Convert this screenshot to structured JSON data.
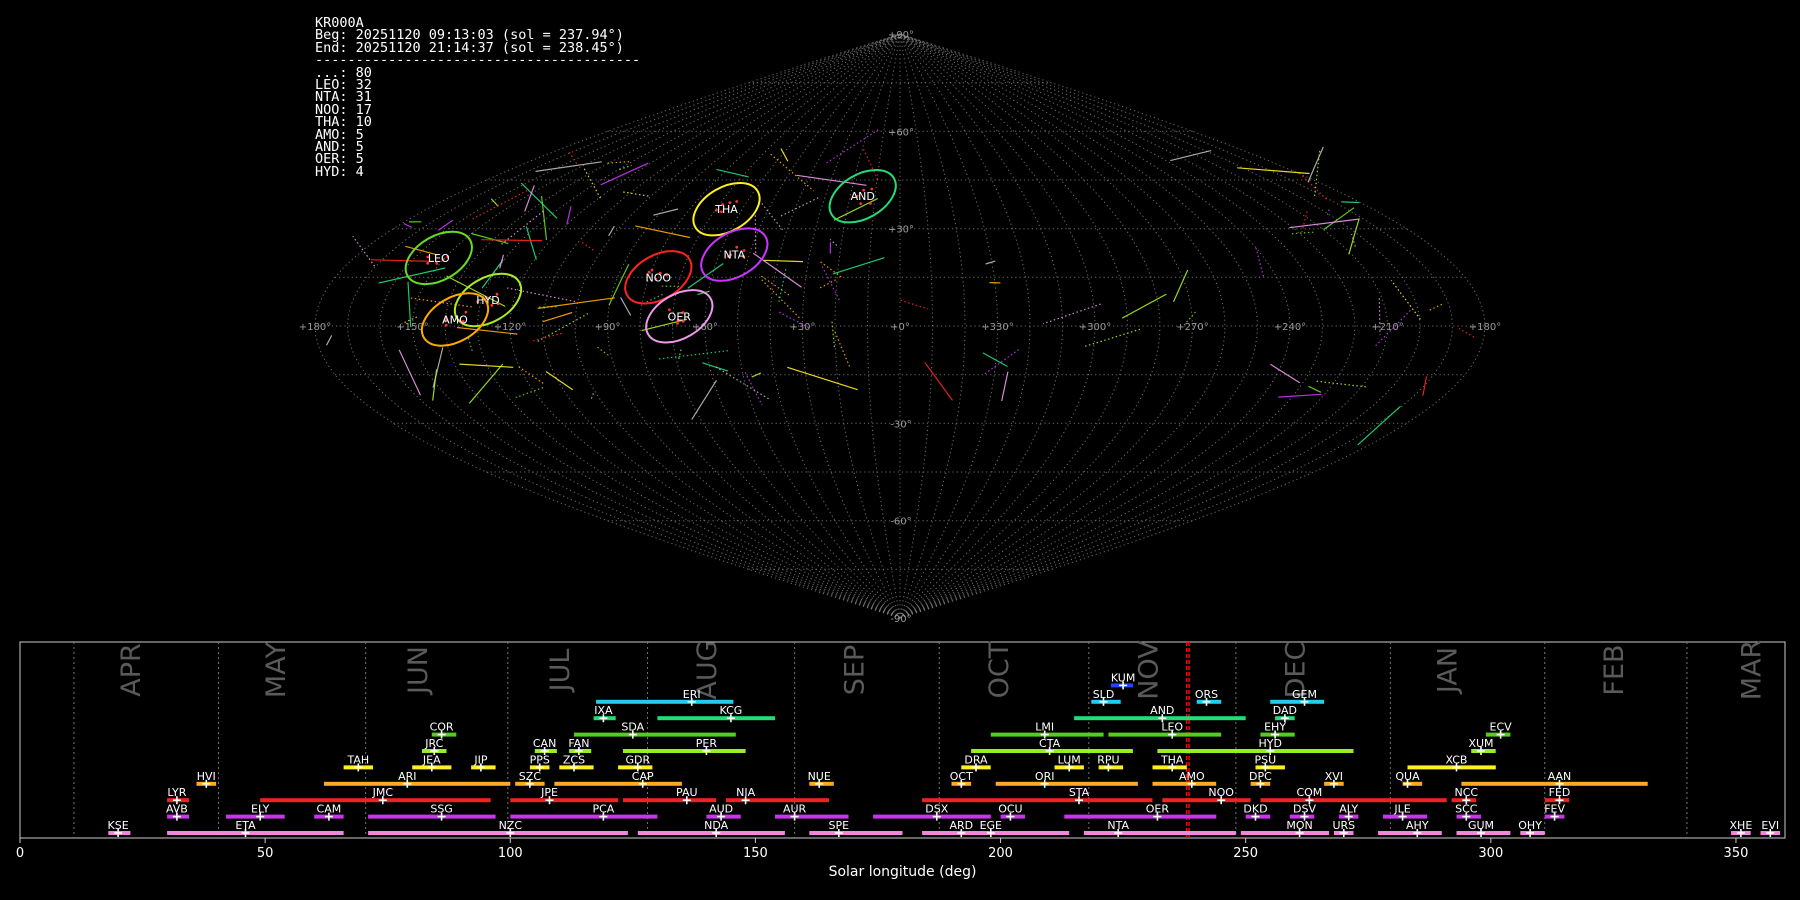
{
  "stats": {
    "station": "KR000A",
    "beg": "Beg: 20251120 09:13:03 (sol = 237.94°)",
    "end": "End: 20251120 21:14:37 (sol = 238.45°)",
    "separator": "----------------------------------------",
    "counts": [
      {
        "code": "...",
        "n": 80
      },
      {
        "code": "LEO",
        "n": 32
      },
      {
        "code": "NTA",
        "n": 31
      },
      {
        "code": "NOO",
        "n": 17
      },
      {
        "code": "THA",
        "n": 10
      },
      {
        "code": "AMO",
        "n": 5
      },
      {
        "code": "AND",
        "n": 5
      },
      {
        "code": "OER",
        "n": 5
      },
      {
        "code": "HYD",
        "n": 4
      }
    ]
  },
  "colors": {
    "background": "#000000",
    "grid": "#808080",
    "now_marker": "#ff0000"
  },
  "chart_data": [
    {
      "type": "scatter",
      "projection": "sinusoidal",
      "lon_tick_labels": [
        "+180°",
        "+150°",
        "+120°",
        "+90°",
        "+60°",
        "+30°",
        "+0°",
        "+330°",
        "+300°",
        "+270°",
        "+240°",
        "+210°",
        "+180°"
      ],
      "lat_tick_labels": [
        {
          "lat": 90,
          "label": "+90°"
        },
        {
          "lat": 60,
          "label": "+60°"
        },
        {
          "lat": 30,
          "label": "+30°"
        },
        {
          "lat": -30,
          "label": "-30°"
        },
        {
          "lat": -60,
          "label": "-60°"
        },
        {
          "lat": -90,
          "label": "-90°"
        }
      ],
      "radiants": [
        {
          "code": "LEO",
          "ra": 152,
          "dec": 21,
          "color": "#66dd22"
        },
        {
          "code": "THA",
          "ra": 66,
          "dec": 36,
          "color": "#ffee22"
        },
        {
          "code": "NTA",
          "ra": 55,
          "dec": 22,
          "color": "#cc33ff"
        },
        {
          "code": "AND",
          "ra": 15,
          "dec": 40,
          "color": "#22dd77"
        },
        {
          "code": "NOO",
          "ra": 77,
          "dec": 15,
          "color": "#ff2222"
        },
        {
          "code": "HYD",
          "ra": 128,
          "dec": 8,
          "color": "#aaee22"
        },
        {
          "code": "AMO",
          "ra": 137,
          "dec": 2,
          "color": "#ffaa00"
        },
        {
          "code": "OER",
          "ra": 68,
          "dec": 3,
          "color": "#ee99ee"
        }
      ]
    },
    {
      "type": "bar",
      "orientation": "horizontal",
      "xlabel": "Solar longitude (deg)",
      "xlim": [
        0,
        360
      ],
      "xticks": [
        0,
        50,
        100,
        150,
        200,
        250,
        300,
        350
      ],
      "current_sol": [
        237.94,
        238.45
      ],
      "months": [
        {
          "name": "APR",
          "start": 11.0,
          "label_at": 24.5
        },
        {
          "name": "MAY",
          "start": 40.5,
          "label_at": 54.0
        },
        {
          "name": "JUN",
          "start": 70.5,
          "label_at": 83.0
        },
        {
          "name": "JUL",
          "start": 99.5,
          "label_at": 112.0
        },
        {
          "name": "AUG",
          "start": 128.0,
          "label_at": 142.0
        },
        {
          "name": "SEP",
          "start": 158.0,
          "label_at": 172.0
        },
        {
          "name": "OCT",
          "start": 187.5,
          "label_at": 201.5
        },
        {
          "name": "NOV",
          "start": 218.0,
          "label_at": 232.0
        },
        {
          "name": "DEC",
          "start": 248.0,
          "label_at": 262.0
        },
        {
          "name": "JAN",
          "start": 279.5,
          "label_at": 293.0
        },
        {
          "name": "FEB",
          "start": 311.0,
          "label_at": 327.0
        },
        {
          "name": "MAR",
          "start": 340.0,
          "label_at": 355.0
        }
      ],
      "showers": [
        {
          "code": "KUM",
          "start": 222.5,
          "end": 227.0,
          "peak": 225.0,
          "row": 9,
          "color": "#2244ff"
        },
        {
          "code": "ERI",
          "start": 117.5,
          "end": 145.5,
          "peak": 137.0,
          "row": 8,
          "color": "#22ccee"
        },
        {
          "code": "SLD",
          "start": 218.5,
          "end": 224.5,
          "peak": 221.0,
          "row": 8,
          "color": "#22ccee"
        },
        {
          "code": "ORS",
          "start": 240.0,
          "end": 245.0,
          "peak": 242.0,
          "row": 8,
          "color": "#22ccee"
        },
        {
          "code": "GEM",
          "start": 255.0,
          "end": 266.0,
          "peak": 262.0,
          "row": 8,
          "color": "#22ccee"
        },
        {
          "code": "IXA",
          "start": 117.0,
          "end": 121.5,
          "peak": 119.0,
          "row": 7,
          "color": "#22dd77"
        },
        {
          "code": "KCG",
          "start": 130.0,
          "end": 154.0,
          "peak": 145.0,
          "row": 7,
          "color": "#22dd77"
        },
        {
          "code": "AND",
          "start": 215.0,
          "end": 250.0,
          "peak": 233.0,
          "row": 7,
          "color": "#22dd77"
        },
        {
          "code": "DAD",
          "start": 256.0,
          "end": 260.0,
          "peak": 258.0,
          "row": 7,
          "color": "#22dd77"
        },
        {
          "code": "COR",
          "start": 84.0,
          "end": 89.0,
          "peak": 86.0,
          "row": 6,
          "color": "#55cc22"
        },
        {
          "code": "SDA",
          "start": 113.0,
          "end": 146.0,
          "peak": 125.0,
          "row": 6,
          "color": "#55cc22"
        },
        {
          "code": "LMI",
          "start": 198.0,
          "end": 221.0,
          "peak": 209.0,
          "row": 6,
          "color": "#55cc22"
        },
        {
          "code": "LEO",
          "start": 222.0,
          "end": 245.0,
          "peak": 235.0,
          "row": 6,
          "color": "#55cc22"
        },
        {
          "code": "EHY",
          "start": 253.0,
          "end": 260.0,
          "peak": 256.0,
          "row": 6,
          "color": "#55cc22"
        },
        {
          "code": "ECV",
          "start": 299.0,
          "end": 304.0,
          "peak": 302.0,
          "row": 6,
          "color": "#55cc22"
        },
        {
          "code": "JRC",
          "start": 82.0,
          "end": 87.0,
          "peak": 84.5,
          "row": 5,
          "color": "#99ee22"
        },
        {
          "code": "CAN",
          "start": 105.0,
          "end": 109.5,
          "peak": 107.0,
          "row": 5,
          "color": "#99ee22"
        },
        {
          "code": "FAN",
          "start": 112.0,
          "end": 116.5,
          "peak": 114.0,
          "row": 5,
          "color": "#99ee22"
        },
        {
          "code": "PER",
          "start": 123.0,
          "end": 148.0,
          "peak": 140.0,
          "row": 5,
          "color": "#99ee22"
        },
        {
          "code": "CTA",
          "start": 194.0,
          "end": 227.0,
          "peak": 210.0,
          "row": 5,
          "color": "#99ee22"
        },
        {
          "code": "HYD",
          "start": 232.0,
          "end": 272.0,
          "peak": 255.0,
          "row": 5,
          "color": "#99ee22"
        },
        {
          "code": "XUM",
          "start": 296.0,
          "end": 301.0,
          "peak": 298.0,
          "row": 5,
          "color": "#99ee22"
        },
        {
          "code": "TAH",
          "start": 66.0,
          "end": 72.0,
          "peak": 69.0,
          "row": 4,
          "color": "#ffee22"
        },
        {
          "code": "JEA",
          "start": 80.0,
          "end": 88.0,
          "peak": 84.0,
          "row": 4,
          "color": "#ffee22"
        },
        {
          "code": "JIP",
          "start": 92.0,
          "end": 97.0,
          "peak": 94.0,
          "row": 4,
          "color": "#ffee22"
        },
        {
          "code": "PPS",
          "start": 104.0,
          "end": 108.0,
          "peak": 106.0,
          "row": 4,
          "color": "#ffee22"
        },
        {
          "code": "ZCS",
          "start": 110.0,
          "end": 117.0,
          "peak": 113.0,
          "row": 4,
          "color": "#ffee22"
        },
        {
          "code": "GDR",
          "start": 122.0,
          "end": 129.0,
          "peak": 126.0,
          "row": 4,
          "color": "#ffee22"
        },
        {
          "code": "DRA",
          "start": 192.0,
          "end": 198.0,
          "peak": 195.0,
          "row": 4,
          "color": "#ffee22"
        },
        {
          "code": "LUM",
          "start": 211.0,
          "end": 217.0,
          "peak": 214.0,
          "row": 4,
          "color": "#ffee22"
        },
        {
          "code": "RPU",
          "start": 220.0,
          "end": 225.0,
          "peak": 222.0,
          "row": 4,
          "color": "#ffee22"
        },
        {
          "code": "THA",
          "start": 231.0,
          "end": 238.0,
          "peak": 235.0,
          "row": 4,
          "color": "#ffee22"
        },
        {
          "code": "PSU",
          "start": 252.0,
          "end": 258.0,
          "peak": 254.0,
          "row": 4,
          "color": "#ffee22"
        },
        {
          "code": "XCB",
          "start": 283.0,
          "end": 301.0,
          "peak": 293.0,
          "row": 4,
          "color": "#ffee22"
        },
        {
          "code": "HVI",
          "start": 36.0,
          "end": 40.0,
          "peak": 38.0,
          "row": 3,
          "color": "#ffaa22"
        },
        {
          "code": "ARI",
          "start": 62.0,
          "end": 100.0,
          "peak": 79.0,
          "row": 3,
          "color": "#ffaa22"
        },
        {
          "code": "SZC",
          "start": 101.0,
          "end": 107.0,
          "peak": 104.0,
          "row": 3,
          "color": "#ffaa22"
        },
        {
          "code": "CAP",
          "start": 109.0,
          "end": 135.0,
          "peak": 127.0,
          "row": 3,
          "color": "#ffaa22"
        },
        {
          "code": "NUE",
          "start": 161.0,
          "end": 166.0,
          "peak": 163.0,
          "row": 3,
          "color": "#ffaa22"
        },
        {
          "code": "OCT",
          "start": 190.0,
          "end": 194.0,
          "peak": 192.0,
          "row": 3,
          "color": "#ffaa22"
        },
        {
          "code": "ORI",
          "start": 199.0,
          "end": 228.0,
          "peak": 209.0,
          "row": 3,
          "color": "#ffaa22"
        },
        {
          "code": "AMO",
          "start": 231.0,
          "end": 244.0,
          "peak": 239.0,
          "row": 3,
          "color": "#ffaa22"
        },
        {
          "code": "DPC",
          "start": 251.0,
          "end": 255.0,
          "peak": 253.0,
          "row": 3,
          "color": "#ffaa22"
        },
        {
          "code": "XVI",
          "start": 266.0,
          "end": 270.0,
          "peak": 268.0,
          "row": 3,
          "color": "#ffaa22"
        },
        {
          "code": "QUA",
          "start": 282.0,
          "end": 286.0,
          "peak": 283.0,
          "row": 3,
          "color": "#ffaa22"
        },
        {
          "code": "AAN",
          "start": 294.0,
          "end": 332.0,
          "peak": 314.0,
          "row": 3,
          "color": "#ffaa22"
        },
        {
          "code": "LYR",
          "start": 30.0,
          "end": 34.5,
          "peak": 32.0,
          "row": 2,
          "color": "#ee2222"
        },
        {
          "code": "JMC",
          "start": 49.0,
          "end": 96.0,
          "peak": 74.0,
          "row": 2,
          "color": "#ee2222"
        },
        {
          "code": "JPE",
          "start": 100.0,
          "end": 122.0,
          "peak": 108.0,
          "row": 2,
          "color": "#ee2222"
        },
        {
          "code": "PAU",
          "start": 123.0,
          "end": 142.0,
          "peak": 136.0,
          "row": 2,
          "color": "#ee2222"
        },
        {
          "code": "NIA",
          "start": 144.0,
          "end": 165.0,
          "peak": 148.0,
          "row": 2,
          "color": "#ee2222"
        },
        {
          "code": "STA",
          "start": 184.0,
          "end": 231.0,
          "peak": 216.0,
          "row": 2,
          "color": "#ee2222"
        },
        {
          "code": "NOO",
          "start": 233.0,
          "end": 251.0,
          "peak": 245.0,
          "row": 2,
          "color": "#ee2222"
        },
        {
          "code": "COM",
          "start": 253.0,
          "end": 291.0,
          "peak": 263.0,
          "row": 2,
          "color": "#ee2222"
        },
        {
          "code": "NCC",
          "start": 292.0,
          "end": 297.0,
          "peak": 295.0,
          "row": 2,
          "color": "#ee2222"
        },
        {
          "code": "FED",
          "start": 311.0,
          "end": 316.0,
          "peak": 314.0,
          "row": 2,
          "color": "#ee2222"
        },
        {
          "code": "AVB",
          "start": 30.0,
          "end": 34.5,
          "peak": 32.0,
          "row": 1,
          "color": "#cc33ee"
        },
        {
          "code": "ELY",
          "start": 42.0,
          "end": 54.0,
          "peak": 49.0,
          "row": 1,
          "color": "#cc33ee"
        },
        {
          "code": "CAM",
          "start": 60.0,
          "end": 66.0,
          "peak": 63.0,
          "row": 1,
          "color": "#cc33ee"
        },
        {
          "code": "SSG",
          "start": 71.0,
          "end": 97.0,
          "peak": 86.0,
          "row": 1,
          "color": "#cc33ee"
        },
        {
          "code": "PCA",
          "start": 100.0,
          "end": 130.0,
          "peak": 119.0,
          "row": 1,
          "color": "#cc33ee"
        },
        {
          "code": "AUD",
          "start": 140.0,
          "end": 147.0,
          "peak": 143.0,
          "row": 1,
          "color": "#cc33ee"
        },
        {
          "code": "AUR",
          "start": 154.0,
          "end": 169.0,
          "peak": 158.0,
          "row": 1,
          "color": "#cc33ee"
        },
        {
          "code": "DSX",
          "start": 174.0,
          "end": 198.0,
          "peak": 187.0,
          "row": 1,
          "color": "#cc33ee"
        },
        {
          "code": "OCU",
          "start": 200.0,
          "end": 205.0,
          "peak": 202.0,
          "row": 1,
          "color": "#cc33ee"
        },
        {
          "code": "OER",
          "start": 213.0,
          "end": 244.0,
          "peak": 232.0,
          "row": 1,
          "color": "#cc33ee"
        },
        {
          "code": "DKD",
          "start": 250.0,
          "end": 255.0,
          "peak": 252.0,
          "row": 1,
          "color": "#cc33ee"
        },
        {
          "code": "DSV",
          "start": 259.0,
          "end": 264.0,
          "peak": 262.0,
          "row": 1,
          "color": "#cc33ee"
        },
        {
          "code": "ALY",
          "start": 269.0,
          "end": 273.0,
          "peak": 271.0,
          "row": 1,
          "color": "#cc33ee"
        },
        {
          "code": "JLE",
          "start": 278.0,
          "end": 287.0,
          "peak": 282.0,
          "row": 1,
          "color": "#cc33ee"
        },
        {
          "code": "SCC",
          "start": 293.0,
          "end": 298.0,
          "peak": 295.0,
          "row": 1,
          "color": "#cc33ee"
        },
        {
          "code": "FEV",
          "start": 311.0,
          "end": 315.0,
          "peak": 313.0,
          "row": 1,
          "color": "#cc33ee"
        },
        {
          "code": "KSE",
          "start": 18.0,
          "end": 22.5,
          "peak": 20.0,
          "row": 0,
          "color": "#ee88dd"
        },
        {
          "code": "ETA",
          "start": 30.0,
          "end": 66.0,
          "peak": 46.0,
          "row": 0,
          "color": "#ee88dd"
        },
        {
          "code": "NZC",
          "start": 71.0,
          "end": 124.0,
          "peak": 100.0,
          "row": 0,
          "color": "#ee88dd"
        },
        {
          "code": "NDA",
          "start": 126.0,
          "end": 156.0,
          "peak": 142.0,
          "row": 0,
          "color": "#ee88dd"
        },
        {
          "code": "SPE",
          "start": 161.0,
          "end": 180.0,
          "peak": 167.0,
          "row": 0,
          "color": "#ee88dd"
        },
        {
          "code": "ARD",
          "start": 184.0,
          "end": 197.0,
          "peak": 192.0,
          "row": 0,
          "color": "#ee88dd"
        },
        {
          "code": "EGE",
          "start": 196.0,
          "end": 214.0,
          "peak": 198.0,
          "row": 0,
          "color": "#ee88dd"
        },
        {
          "code": "NTA",
          "start": 217.0,
          "end": 248.0,
          "peak": 224.0,
          "row": 0,
          "color": "#ee88dd"
        },
        {
          "code": "MON",
          "start": 249.0,
          "end": 267.0,
          "peak": 261.0,
          "row": 0,
          "color": "#ee88dd"
        },
        {
          "code": "URS",
          "start": 268.0,
          "end": 272.0,
          "peak": 270.0,
          "row": 0,
          "color": "#ee88dd"
        },
        {
          "code": "AHY",
          "start": 277.0,
          "end": 290.0,
          "peak": 285.0,
          "row": 0,
          "color": "#ee88dd"
        },
        {
          "code": "GUM",
          "start": 293.0,
          "end": 304.0,
          "peak": 298.0,
          "row": 0,
          "color": "#ee88dd"
        },
        {
          "code": "OHY",
          "start": 306.0,
          "end": 311.0,
          "peak": 308.0,
          "row": 0,
          "color": "#ee88dd"
        },
        {
          "code": "XHE",
          "start": 349.0,
          "end": 353.0,
          "peak": 351.0,
          "row": 0,
          "color": "#ee88dd"
        },
        {
          "code": "EVI",
          "start": 355.0,
          "end": 359.0,
          "peak": 357.0,
          "row": 0,
          "color": "#ee88dd"
        }
      ]
    }
  ]
}
